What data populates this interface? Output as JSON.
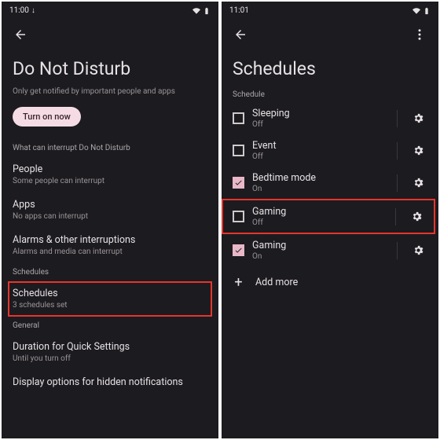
{
  "left": {
    "status": {
      "time": "11:00"
    },
    "title": "Do Not Disturb",
    "subtitle": "Only get notified by important people and apps",
    "turn_on": "Turn on now",
    "section_interrupt": "What can interrupt Do Not Disturb",
    "people": {
      "title": "People",
      "sub": "Some people can interrupt"
    },
    "apps": {
      "title": "Apps",
      "sub": "No apps can interrupt"
    },
    "alarms": {
      "title": "Alarms & other interruptions",
      "sub": "Alarms and media can interrupt"
    },
    "section_schedules": "Schedules",
    "schedules": {
      "title": "Schedules",
      "sub": "3 schedules set"
    },
    "section_general": "General",
    "duration": {
      "title": "Duration for Quick Settings",
      "sub": "Until you turn off"
    },
    "display_opts": {
      "title": "Display options for hidden notifications"
    }
  },
  "right": {
    "status": {
      "time": "11:01"
    },
    "title": "Schedules",
    "section_label": "Schedule",
    "items": [
      {
        "label": "Sleeping",
        "state": "Off",
        "checked": false
      },
      {
        "label": "Event",
        "state": "Off",
        "checked": false
      },
      {
        "label": "Bedtime mode",
        "state": "On",
        "checked": true
      },
      {
        "label": "Gaming",
        "state": "Off",
        "checked": false,
        "highlight": true
      },
      {
        "label": "Gaming",
        "state": "On",
        "checked": true
      }
    ],
    "add_more": "Add more"
  }
}
